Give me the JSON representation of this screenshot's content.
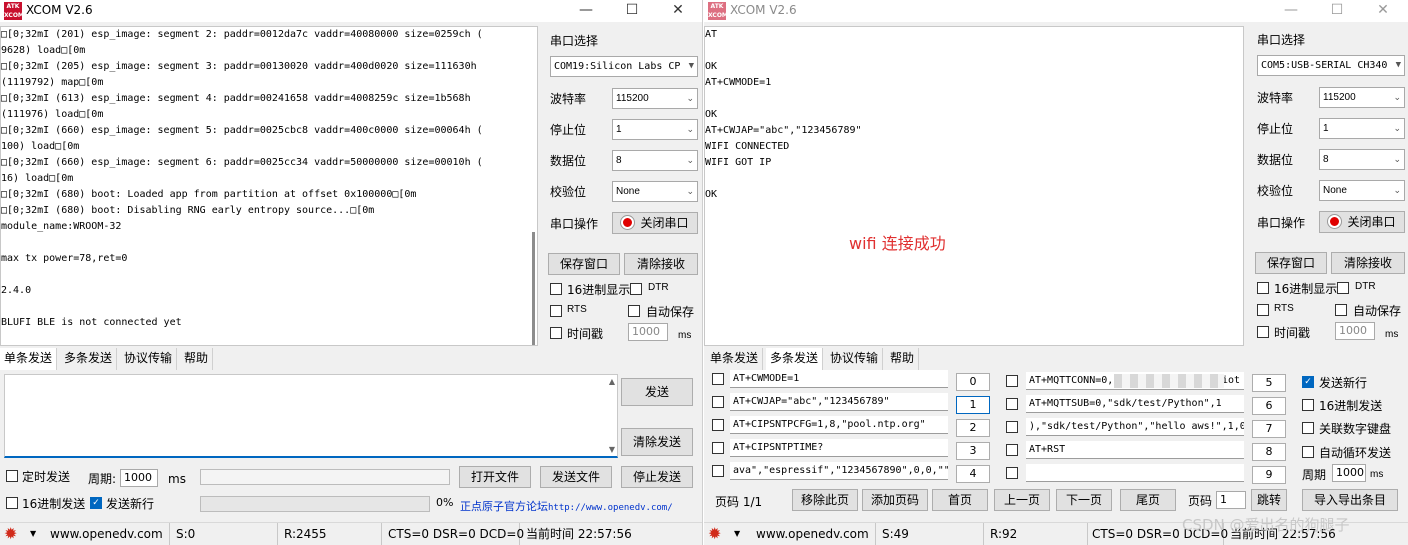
{
  "app_title": "XCOM V2.6",
  "logo_text": [
    "ATK",
    "XCOM"
  ],
  "window_controls": {
    "minimize": "—",
    "maximize": "☐",
    "close": "✕"
  },
  "left": {
    "rx_lines": [
      "□[0;32mI (201) esp_image: segment 2: paddr=0012da7c vaddr=40080000 size=0259ch (",
      "9628) load□[0m",
      "□[0;32mI (205) esp_image: segment 3: paddr=00130020 vaddr=400d0020 size=111630h",
      "(1119792) map□[0m",
      "□[0;32mI (613) esp_image: segment 4: paddr=00241658 vaddr=4008259c size=1b568h",
      "(111976) load□[0m",
      "□[0;32mI (660) esp_image: segment 5: paddr=0025cbc8 vaddr=400c0000 size=00064h (",
      "100) load□[0m",
      "□[0;32mI (660) esp_image: segment 6: paddr=0025cc34 vaddr=50000000 size=00010h (",
      "16) load□[0m",
      "□[0;32mI (680) boot: Loaded app from partition at offset 0x100000□[0m",
      "□[0;32mI (680) boot: Disabling RNG early entropy source...□[0m",
      "module_name:WROOM-32",
      "",
      "max tx power=78,ret=0",
      "",
      "2.4.0",
      "",
      "BLUFI BLE is not connected yet"
    ],
    "port_label": "串口选择",
    "port_value": "COM19:Silicon Labs CP",
    "baud_label": "波特率",
    "baud_value": "115200",
    "stop_label": "停止位",
    "stop_value": "1",
    "data_label": "数据位",
    "data_value": "8",
    "parity_label": "校验位",
    "parity_value": "None",
    "op_label": "串口操作",
    "close_port": "关闭串口",
    "save_window": "保存窗口",
    "clear_rx": "清除接收",
    "hex_display": "16进制显示",
    "dtr": "DTR",
    "rts": "RTS",
    "auto_save": "自动保存",
    "timestamp": "时间戳",
    "ts_value": "1000",
    "ts_unit": "ms",
    "tabs": [
      "单条发送",
      "多条发送",
      "协议传输",
      "帮助"
    ],
    "send": "发送",
    "clear_send": "清除发送",
    "timed_send": "定时发送",
    "period_label": "周期:",
    "period_value": "1000",
    "period_unit": "ms",
    "open_file": "打开文件",
    "send_file": "发送文件",
    "stop_send": "停止发送",
    "hex_send": "16进制发送",
    "newline_send": "发送新行",
    "progress_pct": "0%",
    "forum_text": "正点原子官方论坛",
    "forum_url": "http://www.openedv.com/",
    "status": {
      "site": "www.openedv.com",
      "s": "S:0",
      "r": "R:2455",
      "lines": "CTS=0 DSR=0 DCD=0",
      "time": "当前时间 22:57:56"
    }
  },
  "right": {
    "rx_lines": [
      "AT",
      "",
      "OK",
      "AT+CWMODE=1",
      "",
      "OK",
      "AT+CWJAP=\"abc\",\"123456789\"",
      "WIFI CONNECTED",
      "WIFI GOT IP",
      "",
      "OK"
    ],
    "annotation": "wifi 连接成功",
    "port_label": "串口选择",
    "port_value": "COM5:USB-SERIAL CH340",
    "baud_label": "波特率",
    "baud_value": "115200",
    "stop_label": "停止位",
    "stop_value": "1",
    "data_label": "数据位",
    "data_value": "8",
    "parity_label": "校验位",
    "parity_value": "None",
    "op_label": "串口操作",
    "close_port": "关闭串口",
    "save_window": "保存窗口",
    "clear_rx": "清除接收",
    "hex_display": "16进制显示",
    "dtr": "DTR",
    "rts": "RTS",
    "auto_save": "自动保存",
    "timestamp": "时间戳",
    "ts_value": "1000",
    "ts_unit": "ms",
    "tabs": [
      "单条发送",
      "多条发送",
      "协议传输",
      "帮助"
    ],
    "multi_left": [
      {
        "cmd": "AT+CWMODE=1",
        "num": "0"
      },
      {
        "cmd": "AT+CWJAP=\"abc\",\"123456789\"",
        "num": "1"
      },
      {
        "cmd": "AT+CIPSNTPCFG=1,8,\"pool.ntp.org\"",
        "num": "2"
      },
      {
        "cmd": "AT+CIPSNTPTIME?",
        "num": "3"
      },
      {
        "cmd": "ava\",\"espressif\",\"1234567890\",0,0,\"\"",
        "num": "4"
      }
    ],
    "multi_right": [
      {
        "cmd": "AT+MQTTCONN=0,",
        "tail": "iot",
        "num": "5"
      },
      {
        "cmd": "AT+MQTTSUB=0,\"sdk/test/Python\",1",
        "num": "6"
      },
      {
        "cmd": "),\"sdk/test/Python\",\"hello aws!\",1,0",
        "num": "7"
      },
      {
        "cmd": "AT+RST",
        "num": "8"
      },
      {
        "cmd": "",
        "num": "9"
      }
    ],
    "opt_newline": "发送新行",
    "opt_hex": "16进制发送",
    "opt_keypad": "关联数字键盘",
    "opt_loop": "自动循环发送",
    "period_label": "周期",
    "period_value": "1000",
    "period_unit": "ms",
    "page_label": "页码",
    "page_count": "1/1",
    "remove_page": "移除此页",
    "add_page": "添加页码",
    "first_page": "首页",
    "prev_page": "上一页",
    "next_page": "下一页",
    "last_page": "尾页",
    "page_input_label": "页码",
    "page_input_value": "1",
    "jump": "跳转",
    "import_export": "导入导出条目",
    "status": {
      "site": "www.openedv.com",
      "s": "S:49",
      "r": "R:92",
      "lines": "CTS=0 DSR=0 DCD=0",
      "time": "当前时间 22:57:56"
    },
    "watermark": "CSDN @爱出名的狗腿子"
  }
}
